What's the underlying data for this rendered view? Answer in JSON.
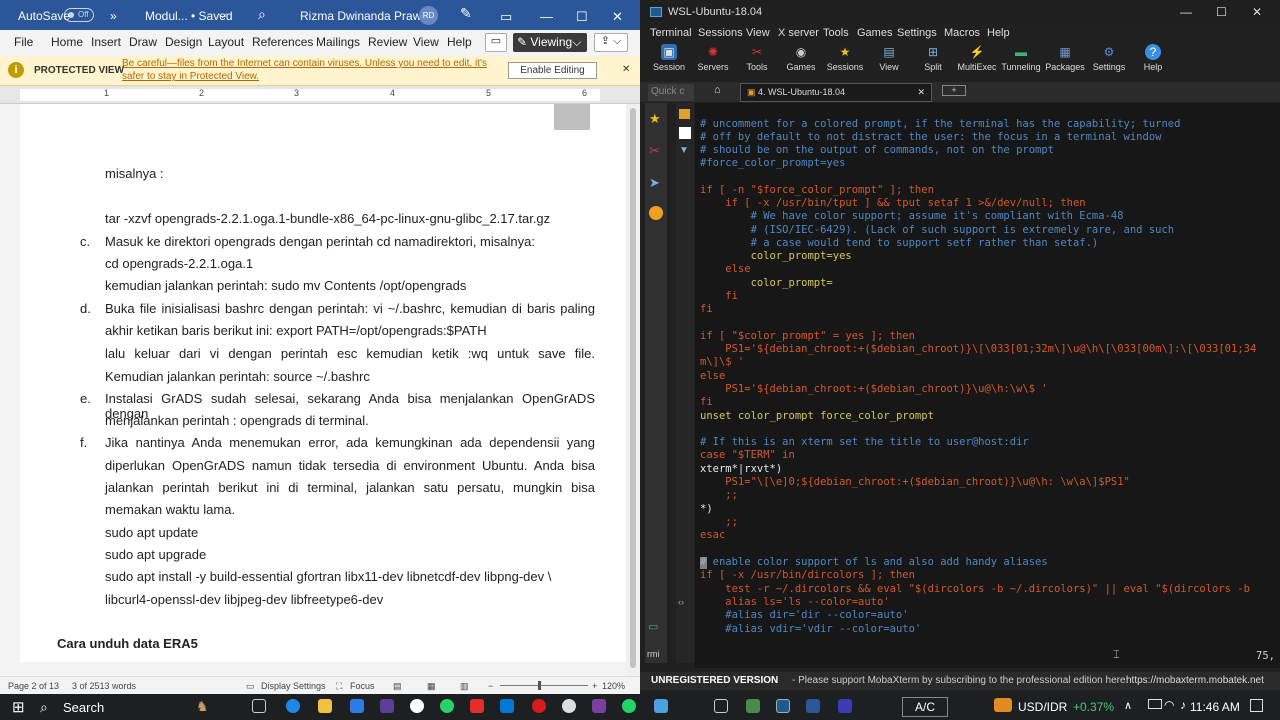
{
  "word": {
    "autosave_label": "AutoSave",
    "toggle_state": "Off",
    "chevrons": "»",
    "doc_title": "Modul... • Saved",
    "title_chevron": "⌵",
    "user_name": "Rizma Dwinanda Prawira",
    "user_initials": "RD",
    "window_controls": [
      "—",
      "☐",
      "✕"
    ],
    "menu": [
      "File",
      "Home",
      "Insert",
      "Draw",
      "Design",
      "Layout",
      "References",
      "Mailings",
      "Review",
      "View",
      "Help"
    ],
    "viewing_label": "Viewing",
    "viewing_chevron": "⌵",
    "protected": {
      "badge": "PROTECTED VIEW",
      "message_line1": "Be careful—files from the Internet can contain viruses. Unless you need to edit, it's",
      "message_line2": "safer to stay in Protected View.",
      "button": "Enable Editing",
      "close": "✕"
    },
    "ruler_numbers": [
      "1",
      "2",
      "3",
      "4",
      "5",
      "6"
    ],
    "document": {
      "misalnya": "misalnya :",
      "tar_cmd": "tar -xzvf opengrads-2.2.1.oga.1-bundle-x86_64-pc-linux-gnu-glibc_2.17.tar.gz",
      "items": [
        {
          "label": "c.",
          "lines": [
            "Masuk ke direktori opengrads dengan perintah cd namadirektori, misalnya:",
            "cd opengrads-2.2.1.oga.1",
            "kemudian jalankan perintah: sudo mv Contents /opt/opengrads"
          ]
        },
        {
          "label": "d.",
          "lines": [
            "Buka file inisialisasi bashrc dengan perintah: vi ~/.bashrc, kemudian di baris paling",
            "akhir ketikan baris berikut ini: export PATH=/opt/opengrads:$PATH",
            "lalu keluar dari vi dengan perintah esc kemudian ketik :wq untuk save file.",
            "Kemudian jalankan perintah: source ~/.bashrc"
          ]
        },
        {
          "label": "e.",
          "lines": [
            "Instalasi GrADS sudah selesai, sekarang Anda bisa menjalankan OpenGrADS dengan",
            "menjalankan perintah : opengrads di terminal."
          ]
        },
        {
          "label": "f.",
          "lines": [
            "Jika nantinya Anda menemukan error, ada kemungkinan ada dependensii yang",
            "diperlukan OpenGrADS namun tidak tersedia di environment Ubuntu. Anda bisa",
            "jalankan perintah berikut ini di terminal, jalankan satu persatu, mungkin bisa",
            "memakan waktu lama.",
            "sudo apt update",
            "sudo apt upgrade",
            "sudo apt install -y build-essential gfortran libx11-dev libnetcdf-dev libpng-dev \\",
            "libcurl4-openssl-dev libjpeg-dev libfreetype6-dev"
          ]
        }
      ],
      "heading": "Cara unduh data ERA5"
    },
    "status": {
      "page": "Page 2 of 13",
      "words": "3 of 2513 words",
      "display_settings": "Display Settings",
      "focus": "Focus",
      "zoom": "120%"
    }
  },
  "moba": {
    "title": "WSL-Ubuntu-18.04",
    "window_controls": [
      "—",
      "☐",
      "✕"
    ],
    "menu": [
      "Terminal",
      "Sessions",
      "View",
      "X server",
      "Tools",
      "Games",
      "Settings",
      "Macros",
      "Help"
    ],
    "toolbar": [
      "Session",
      "Servers",
      "Tools",
      "Games",
      "Sessions",
      "View",
      "Split",
      "MultiExec",
      "Tunneling",
      "Packages",
      "Settings",
      "Help"
    ],
    "quick_connect_placeholder": "Quick c",
    "tab_label": "4. WSL-Ubuntu-18.04",
    "tab_close": "✕",
    "new_tab": "+",
    "sidebar_text": "rmi",
    "line_number": "75,",
    "status": {
      "unregistered": "UNREGISTERED VERSION",
      "message": "-  Please support MobaXterm by subscribing to the professional edition here:",
      "link": "https://mobaxterm.mobatek.net"
    },
    "terminal_lines": [
      "# uncomment for a colored prompt, if the terminal has the capability; turned",
      "# off by default to not distract the user: the focus in a terminal window",
      "# should be on the output of commands, not on the prompt",
      "#force_color_prompt=yes",
      "",
      "if [ -n \"$force_color_prompt\" ]; then",
      "    if [ -x /usr/bin/tput ] && tput setaf 1 >&/dev/null; then",
      "        # We have color support; assume it's compliant with Ecma-48",
      "        # (ISO/IEC-6429). (Lack of such support is extremely rare, and such",
      "        # a case would tend to support setf rather than setaf.)",
      "        color_prompt=yes",
      "    else",
      "        color_prompt=",
      "    fi",
      "fi",
      "",
      "if [ \"$color_prompt\" = yes ]; then",
      "    PS1='${debian_chroot:+($debian_chroot)}\\[\\033[01;32m\\]\\u@\\h\\[\\033[00m\\]:\\[\\033[01;34",
      "m\\]\\$ '",
      "else",
      "    PS1='${debian_chroot:+($debian_chroot)}\\u@\\h:\\w\\$ '",
      "fi",
      "unset color_prompt force_color_prompt",
      "",
      "# If this is an xterm set the title to user@host:dir",
      "case \"$TERM\" in",
      "xterm*|rxvt*)",
      "    PS1=\"\\[\\e]0;${debian_chroot:+($debian_chroot)}\\u@\\h: \\w\\a\\]$PS1\"",
      "    ;;",
      "*)",
      "    ;;",
      "esac",
      "",
      "# enable color support of ls and also add handy aliases",
      "if [ -x /usr/bin/dircolors ]; then",
      "    test -r ~/.dircolors && eval \"$(dircolors -b ~/.dircolors)\" || eval \"$(dircolors -b",
      "    alias ls='ls --color=auto'",
      "    #alias dir='dir --color=auto'",
      "    #alias vdir='vdir --color=auto'"
    ]
  },
  "taskbar": {
    "search": "Search",
    "ac": "A/C",
    "ticker": "USD/IDR",
    "change": "+0.37%",
    "time": "11:46 AM"
  },
  "colors": {
    "word_blue": "#2b579a",
    "terminal_bg": "#171717",
    "comment": "#4d88c6",
    "keyword": "#d4582b"
  }
}
